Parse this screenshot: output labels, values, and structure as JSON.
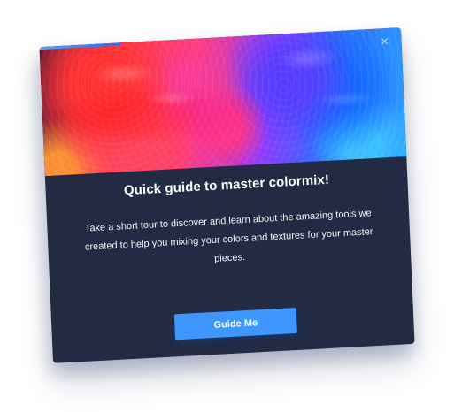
{
  "dialog": {
    "title": "Quick guide to master colormix!",
    "description": "Take a short tour to discover and learn about the amazing tools we created to help you mixing your colors and textures for your master pieces.",
    "primary_action": {
      "label": "Guide Me"
    },
    "close_icon": "×"
  },
  "colors": {
    "card_background": "#232b44",
    "button_background": "#3d97ff",
    "text": "#ffffff",
    "shadow": "#2c3a69"
  },
  "icons": {
    "close": "close-icon"
  }
}
